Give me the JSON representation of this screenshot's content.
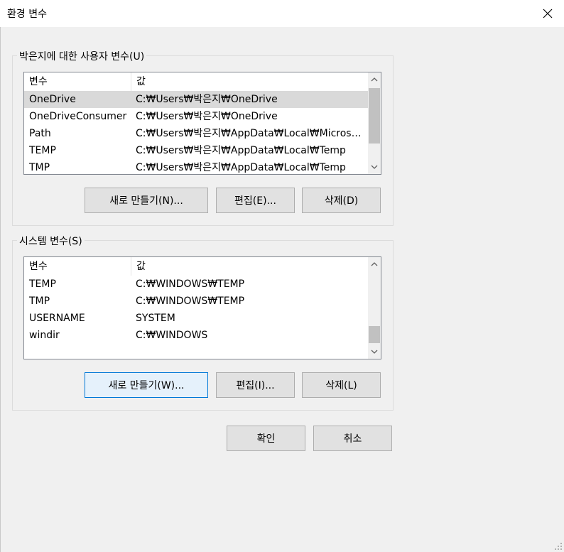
{
  "window": {
    "title": "환경 변수",
    "close_icon": "close-icon"
  },
  "user_section": {
    "group_label": "박은지에 대한 사용자 변수(U)",
    "columns": [
      "변수",
      "값"
    ],
    "rows": [
      {
        "name": "OneDrive",
        "value": "C:₩Users₩박은지₩OneDrive",
        "selected": true
      },
      {
        "name": "OneDriveConsumer",
        "value": "C:₩Users₩박은지₩OneDrive",
        "selected": false
      },
      {
        "name": "Path",
        "value": "C:₩Users₩박은지₩AppData₩Local₩Microsoft...",
        "selected": false
      },
      {
        "name": "TEMP",
        "value": "C:₩Users₩박은지₩AppData₩Local₩Temp",
        "selected": false
      },
      {
        "name": "TMP",
        "value": "C:₩Users₩박은지₩AppData₩Local₩Temp",
        "selected": false
      }
    ],
    "buttons": {
      "new": "새로 만들기(N)...",
      "edit": "편집(E)...",
      "delete": "삭제(D)"
    }
  },
  "system_section": {
    "group_label": "시스템 변수(S)",
    "columns": [
      "변수",
      "값"
    ],
    "rows": [
      {
        "name": "TEMP",
        "value": "C:₩WINDOWS₩TEMP"
      },
      {
        "name": "TMP",
        "value": "C:₩WINDOWS₩TEMP"
      },
      {
        "name": "USERNAME",
        "value": "SYSTEM"
      },
      {
        "name": "windir",
        "value": "C:₩WINDOWS"
      }
    ],
    "buttons": {
      "new": "새로 만들기(W)...",
      "edit": "편집(I)...",
      "delete": "삭제(L)"
    }
  },
  "footer": {
    "ok": "확인",
    "cancel": "취소"
  },
  "colors": {
    "selection": "#d9d9d9",
    "focus_border": "#0078d7",
    "focus_fill": "#e5f1fb"
  }
}
